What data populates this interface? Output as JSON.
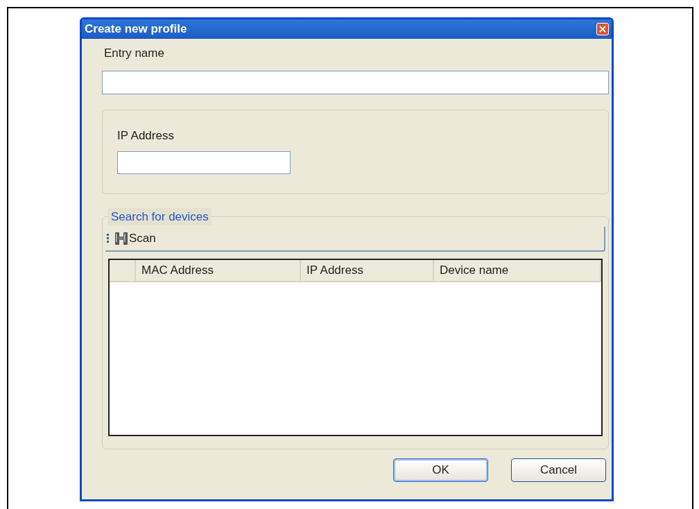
{
  "window": {
    "title": "Create new profile"
  },
  "entry_name": {
    "label": "Entry name"
  },
  "ip_group": {
    "label": "IP Address"
  },
  "search": {
    "legend": "Search for devices",
    "toolbar": {
      "scan_label": "Scan"
    },
    "table": {
      "columns": [
        "MAC Address",
        "IP Address",
        "Device name"
      ]
    }
  },
  "buttons": [
    {
      "label": "OK",
      "default": true
    },
    {
      "label": "Cancel",
      "default": false
    }
  ]
}
